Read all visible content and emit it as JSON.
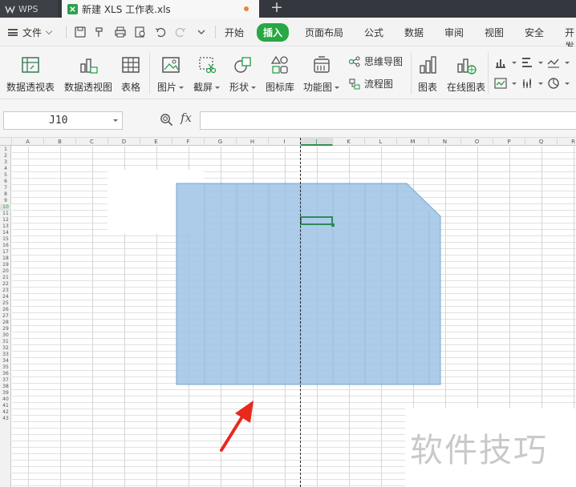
{
  "titlebar": {
    "app_tab": "WPS",
    "doc_tab": "新建 XLS 工作表.xls",
    "new_tab": "+"
  },
  "menubar": {
    "file": "文件",
    "items": [
      "开始",
      "插入",
      "页面布局",
      "公式",
      "数据",
      "审阅",
      "视图",
      "安全",
      "开发"
    ],
    "active": "插入",
    "accent_color": "#28a745"
  },
  "ribbon": {
    "buttons": [
      {
        "label": "数据透视表",
        "icon": "pivot-table-icon"
      },
      {
        "label": "数据透视图",
        "icon": "pivot-chart-icon"
      },
      {
        "label": "表格",
        "icon": "table-icon"
      },
      {
        "label": "图片",
        "icon": "picture-icon"
      },
      {
        "label": "截屏",
        "icon": "screenshot-icon"
      },
      {
        "label": "形状",
        "icon": "shapes-icon"
      },
      {
        "label": "图标库",
        "icon": "icon-library-icon"
      },
      {
        "label": "功能图",
        "icon": "function-chart-icon"
      },
      {
        "label": "图表",
        "icon": "chart-icon"
      },
      {
        "label": "在线图表",
        "icon": "online-chart-icon"
      }
    ],
    "small_buttons": [
      {
        "label": "思维导图",
        "icon": "mindmap-icon"
      },
      {
        "label": "流程图",
        "icon": "flowchart-icon"
      }
    ]
  },
  "formula_bar": {
    "cell_ref": "J10",
    "fx": "fx",
    "formula_value": ""
  },
  "sheet": {
    "columns": [
      "A",
      "B",
      "C",
      "D",
      "E",
      "F",
      "G",
      "H",
      "I",
      "J",
      "K",
      "L",
      "M",
      "N",
      "O",
      "P",
      "Q",
      "R"
    ],
    "active_column": "J",
    "rows": [
      "1",
      "2",
      "3",
      "4",
      "5",
      "6",
      "7",
      "8",
      "9",
      "10",
      "11",
      "12",
      "13",
      "14",
      "15",
      "16",
      "17",
      "18",
      "19",
      "20",
      "21",
      "22",
      "23",
      "24",
      "25",
      "26",
      "27",
      "28",
      "29",
      "30",
      "31",
      "32",
      "33",
      "34",
      "35",
      "36",
      "37",
      "38",
      "39",
      "40",
      "41",
      "42",
      "43"
    ],
    "active_row": "10",
    "selected_cell": "J10",
    "shape_fill": "#9dc3e6",
    "arrow_color": "#e8291c"
  },
  "watermark": "软件技巧"
}
